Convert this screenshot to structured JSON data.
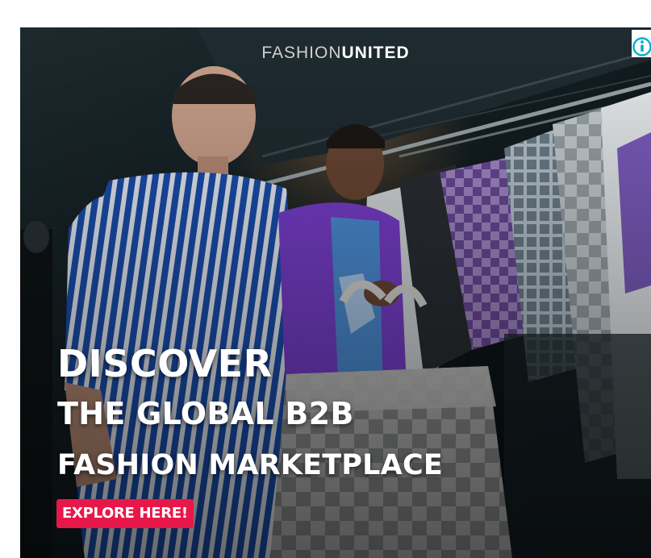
{
  "ad": {
    "brand_part1": "FASHION",
    "brand_part2": "UNITED",
    "headline_line1": "DISCOVER",
    "headline_line2": "THE GLOBAL B2B",
    "headline_line3": "FASHION MARKETPLACE",
    "cta_label": "EXPLORE HERE!",
    "info_icon": "info-icon"
  },
  "colors": {
    "cta_background": "#e8174a",
    "info_icon": "#00aecd",
    "headline_text": "#ffffff"
  }
}
